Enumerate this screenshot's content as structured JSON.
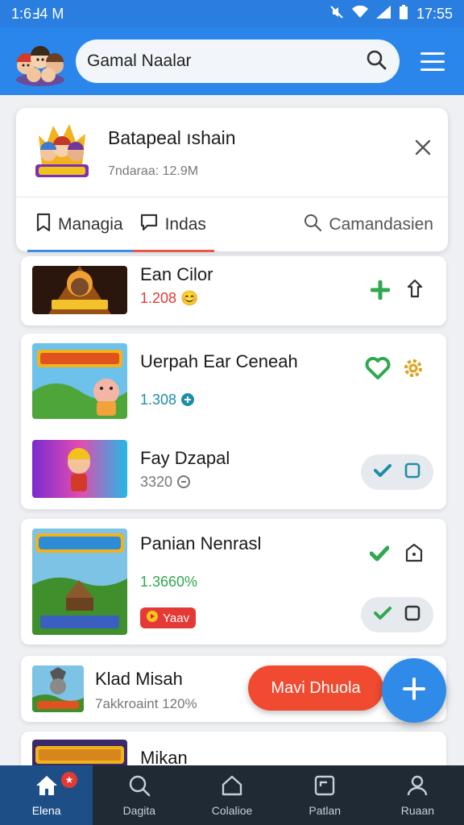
{
  "status": {
    "time_left": "1:6Ⅎ4 M",
    "time_right": "17:55"
  },
  "search": {
    "text": "Gamal Naalar"
  },
  "header": {
    "title": "Batapeal ıshain",
    "subtitle": "7ndaraa: 12.9M",
    "tabs": [
      {
        "label": "Managia"
      },
      {
        "label": "Indas"
      },
      {
        "label": "Camandasien"
      }
    ]
  },
  "items": [
    {
      "title": "Ean Cilor",
      "meta": "1.208",
      "meta_color": "#e53935"
    },
    {
      "title": "Uerpah Ear Ceneah",
      "meta": "1.308",
      "meta_color": "#1d8ea8"
    },
    {
      "title": "Fay Dzapal",
      "meta": "3320",
      "meta_color": "#777777"
    },
    {
      "title": "Panian Nenrasl",
      "meta": "1.3660%",
      "meta_color": "#2fa84f",
      "badge": "Yaav"
    },
    {
      "title": "Klad Misah",
      "meta": "7akkroaint 120%",
      "meta_color": "#777777"
    },
    {
      "title": "Mikan"
    }
  ],
  "fab": {
    "label": "Mavi Dhuola"
  },
  "nav": [
    {
      "label": "Elena",
      "badge": "★"
    },
    {
      "label": "Dagita"
    },
    {
      "label": "Colalioe"
    },
    {
      "label": "Patlan"
    },
    {
      "label": "Ruaan"
    }
  ],
  "colors": {
    "primary": "#2a86ea",
    "accent_red": "#f04a30",
    "check_green": "#2fa84f",
    "nav_bg": "#1f2a35"
  }
}
